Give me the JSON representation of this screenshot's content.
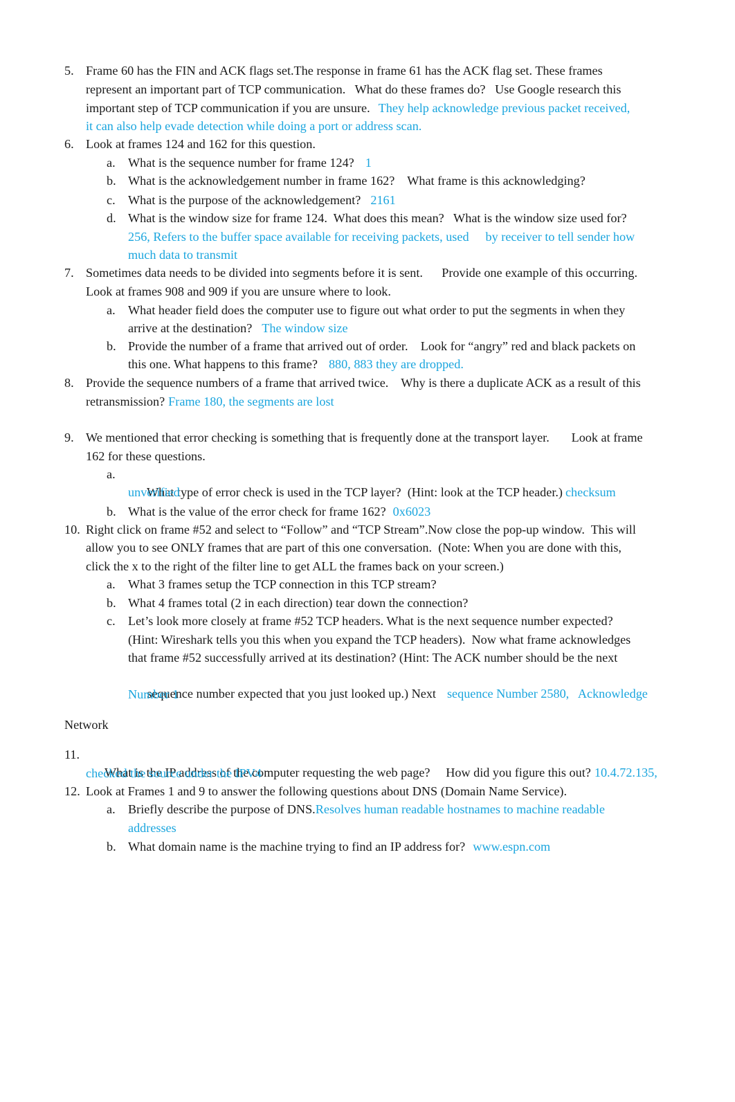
{
  "accent_color": "#1aa5de",
  "questions": {
    "q5": {
      "number": "5.",
      "lines": [
        "Frame 60 has the FIN and ACK flags set.The response in frame 61 has the ACK flag set. These frames",
        "represent an important part of TCP communication.   What do these frames do?   Use Google research this",
        "important step of TCP communication if you are unsure."
      ],
      "answer_lines": [
        "They help acknowledge previous packet received,",
        "it can also help evade detection while doing a port or address scan."
      ]
    },
    "q6": {
      "number": "6.",
      "text": "Look at frames 124 and 162 for this question.",
      "sub": {
        "a": {
          "label": "a.",
          "text": "What is the sequence number for frame 124?",
          "answer": "1"
        },
        "b": {
          "label": "b.",
          "text": "What is the acknowledgement number in frame 162?    What frame is this acknowledging?"
        },
        "c": {
          "label": "c.",
          "text": "What is the purpose of the acknowledgement?",
          "answer": "2161"
        },
        "d": {
          "label": "d.",
          "text": "What is the window size for frame 124.  What does this mean?   What is the window size used for?",
          "answer_lines": [
            "256, Refers to the buffer space available for receiving packets, used",
            "by receiver to tell sender how",
            "much data to transmit"
          ]
        }
      }
    },
    "q7": {
      "number": "7.",
      "lines": [
        "Sometimes data needs to be divided into segments before it is sent.      Provide one example of this occurring.",
        "Look at frames 908 and 909 if you are unsure where to look."
      ],
      "sub": {
        "a": {
          "label": "a.",
          "lines": [
            "What header field does the computer use to figure out what order to put the segments in when they",
            "arrive at the destination?"
          ],
          "answer": "The window size"
        },
        "b": {
          "label": "b.",
          "lines": [
            "Provide the number of a frame that arrived out of order.    Look for “angry” red and black packets on",
            "this one. What happens to this frame?"
          ],
          "answer": "880, 883 they are dropped."
        }
      }
    },
    "q8": {
      "number": "8.",
      "lines": [
        "Provide the sequence numbers of a frame that arrived twice.    Why is there a duplicate ACK as a result of this",
        "retransmission?"
      ],
      "answer": "Frame 180, the segments are lost"
    },
    "q9": {
      "number": "9.",
      "lines": [
        "We mentioned that error checking is something that is frequently done at the transport layer.       Look at frame",
        "162 for these questions."
      ],
      "sub": {
        "a": {
          "label": "a.",
          "text": "What type of error check is used in the TCP layer?  (Hint: look at the TCP header.)",
          "answer_lines": [
            "checksum",
            "unverified"
          ]
        },
        "b": {
          "label": "b.",
          "text": "What is the value of the error check for frame 162?",
          "answer": "0x6023"
        }
      }
    },
    "q10": {
      "number": "10.",
      "lines": [
        "Right click on frame #52 and select to “Follow” and “TCP Stream”.Now close the pop-up window.  This will",
        "allow you to see ONLY frames that are part of this one conversation.  (Note: When you are done with this,",
        "click the x to the right of the filter line to get ALL the frames back on your screen.)"
      ],
      "sub": {
        "a": {
          "label": "a.",
          "text": "What 3 frames setup the TCP connection in this TCP stream?"
        },
        "b": {
          "label": "b.",
          "text": "What 4 frames total (2 in each direction) tear down the connection?"
        },
        "c": {
          "label": "c.",
          "lines": [
            "Let’s look more closely at frame #52 TCP headers. What is the next sequence number expected?",
            "(Hint: Wireshark tells you this when you expand the TCP headers).  Now what frame acknowledges",
            "that frame #52 successfully arrived at its destination? (Hint: The ACK number should be the next",
            "sequence number expected that you just looked up.) Next"
          ],
          "answer_lines": [
            "sequence Number 2580,   Acknowledge",
            "Number 1"
          ]
        }
      }
    },
    "section_network": "Network",
    "q11": {
      "number": "11.",
      "text": "What is the IP address of the computer requesting the web page?     How did you figure this out?",
      "answer_lines": [
        "10.4.72.135,",
        "checked the source under the IPV4"
      ]
    },
    "q12": {
      "number": "12.",
      "text": "Look at Frames 1 and 9 to answer the following questions about DNS (Domain Name Service).",
      "sub": {
        "a": {
          "label": "a.",
          "text": "Briefly describe the purpose of DNS.",
          "answer_lines": [
            "Resolves human readable hostnames to machine readable",
            "addresses"
          ]
        },
        "b": {
          "label": "b.",
          "text": "What domain name is the machine trying to find an IP address for?",
          "answer": "www.espn.com"
        }
      }
    }
  }
}
